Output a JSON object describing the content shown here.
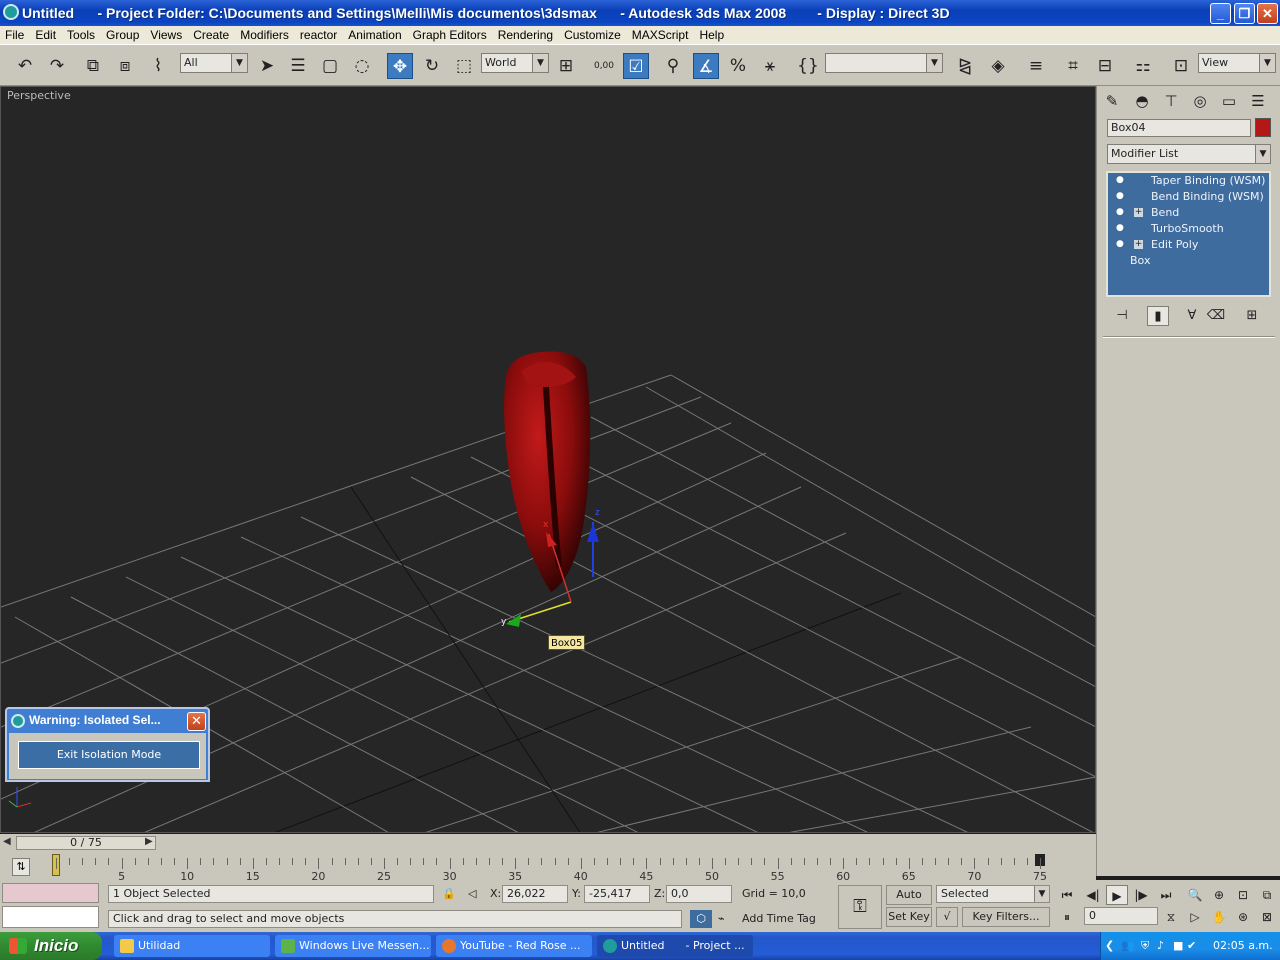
{
  "window": {
    "title": "Untitled      - Project Folder: C:\\Documents and Settings\\Melli\\Mis documentos\\3dsmax      - Autodesk 3ds Max 2008        - Display : Direct 3D"
  },
  "menu": [
    "File",
    "Edit",
    "Tools",
    "Group",
    "Views",
    "Create",
    "Modifiers",
    "reactor",
    "Animation",
    "Graph Editors",
    "Rendering",
    "Customize",
    "MAXScript",
    "Help"
  ],
  "toolbar": {
    "selection_filter": "All",
    "reference_coord": "World",
    "spinner_snap": "0,00",
    "named_selection": "",
    "view_dropdown": "View"
  },
  "viewport": {
    "label": "Perspective",
    "tooltip": "Box05",
    "gizmo_x": "x",
    "gizmo_y": "y",
    "gizmo_z": "z"
  },
  "warning_dialog": {
    "title": "Warning: Isolated Sel...",
    "button": "Exit Isolation Mode"
  },
  "command_panel": {
    "object_name": "Box04",
    "object_color": "#b51616",
    "modifier_list": "Modifier List",
    "stack": [
      {
        "label": "Taper Binding (WSM)",
        "expandable": false
      },
      {
        "label": "Bend Binding (WSM)",
        "expandable": false
      },
      {
        "label": "Bend",
        "expandable": true
      },
      {
        "label": "TurboSmooth",
        "expandable": false
      },
      {
        "label": "Edit Poly",
        "expandable": true
      }
    ],
    "base_object": "Box"
  },
  "timeline": {
    "frame_display": "0 / 75",
    "tick_labels": [
      "5",
      "10",
      "15",
      "20",
      "25",
      "30",
      "35",
      "40",
      "45",
      "50",
      "55",
      "60",
      "65",
      "70",
      "75"
    ]
  },
  "status": {
    "selection": "1 Object Selected",
    "prompt": "Click and drag to select and move objects",
    "x_label": "X:",
    "x_value": "26,022",
    "y_label": "Y:",
    "y_value": "-25,417",
    "z_label": "Z:",
    "z_value": "0,0",
    "grid": "Grid = 10,0",
    "add_time_tag": "Add Time Tag",
    "auto_key": "Auto Key",
    "set_key": "Set Key",
    "key_mode": "Selected",
    "key_filters": "Key Filters...",
    "current_frame": "0"
  },
  "taskbar": {
    "start": "Inicio",
    "tasks": [
      {
        "label": "Utilidad",
        "active": false
      },
      {
        "label": "Windows Live Messen...",
        "active": false
      },
      {
        "label": "YouTube - Red Rose ...",
        "active": false
      },
      {
        "label": "Untitled      - Project ...",
        "active": true
      }
    ],
    "clock": "02:05 a.m."
  }
}
